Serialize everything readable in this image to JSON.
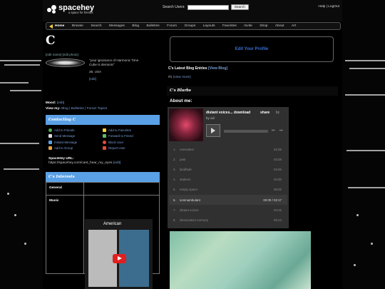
{
  "header": {
    "logo_text": "spacehey",
    "logo_sub": "a space for friends",
    "search_label": "Search Users:",
    "search_placeholder": "",
    "search_button": "Search",
    "top_links": "Help | LogOut"
  },
  "nav": {
    "items": [
      "Home",
      "Browse",
      "Search",
      "Messages",
      "Blog",
      "Bulletins",
      "Forum",
      "Groups",
      "Layouts",
      "Favorites",
      "Invite",
      "Shop",
      "About",
      "Art"
    ]
  },
  "profile": {
    "name": "C",
    "edit_links": "[edit name] [edit photo]",
    "quote": "\"your ignorance of Harmonic Time Cube is demonic\"",
    "age_loc": "28, USA",
    "edit": "[edit]",
    "mood_label": "Mood:",
    "mood_edit": "[edit]",
    "viewmy_label": "View my:",
    "viewmy_links": "Blog | Bulletins | Forum Topics"
  },
  "contact": {
    "title": "Contacting C",
    "items": [
      {
        "label": "Add to Friends",
        "icon": "add-friend-icon",
        "color": "#4caf50"
      },
      {
        "label": "Add to Favorites",
        "icon": "star-icon",
        "color": "#f4d03f"
      },
      {
        "label": "Send Message",
        "icon": "message-icon",
        "color": "#dddddd"
      },
      {
        "label": "Forward to Friend",
        "icon": "forward-icon",
        "color": "#66bb6a"
      },
      {
        "label": "Instant Message",
        "icon": "chat-icon",
        "color": "#5aa0e6"
      },
      {
        "label": "Block User",
        "icon": "block-icon",
        "color": "#e74c3c"
      },
      {
        "label": "Add to Group",
        "icon": "group-icon",
        "color": "#e8a33d"
      },
      {
        "label": "Report User",
        "icon": "report-icon",
        "color": "#e74c3c"
      }
    ]
  },
  "url": {
    "label": "SpaceHey URL:",
    "value": "https://spacehey.com/cant_hear_my_eyes",
    "edit": "[edit]"
  },
  "interests": {
    "title": "C's Interests",
    "rows": [
      "General",
      "Music"
    ],
    "video_title": "American"
  },
  "right": {
    "edit_profile": "Edit Your Profile",
    "blog_title": "C's Latest Blog Entries",
    "blog_view": "[View Blog]",
    "blog_entry": "#1",
    "blog_entry_link": "(view more)",
    "blurbs_title": "C's Blurbs",
    "about_me": "About me:"
  },
  "player": {
    "title": "distant voices... download",
    "share": "share",
    "bc": "bc",
    "by": "by aiii",
    "tracks": [
      {
        "n": "1.",
        "name": "overwaten",
        "time": "02:36"
      },
      {
        "n": "2.",
        "name": "past",
        "time": "03:28"
      },
      {
        "n": "3.",
        "name": "landfade",
        "time": "04:46"
      },
      {
        "n": "4.",
        "name": "stations",
        "time": "04:30"
      },
      {
        "n": "5.",
        "name": "empty space",
        "time": "06:32"
      },
      {
        "n": "6.",
        "name": "somnambulant",
        "time": "00:00 / 02:17"
      },
      {
        "n": "7.",
        "name": "distant voices",
        "time": "04:15"
      },
      {
        "n": "8.",
        "name": "dissociation memory",
        "time": "06:13"
      }
    ]
  }
}
